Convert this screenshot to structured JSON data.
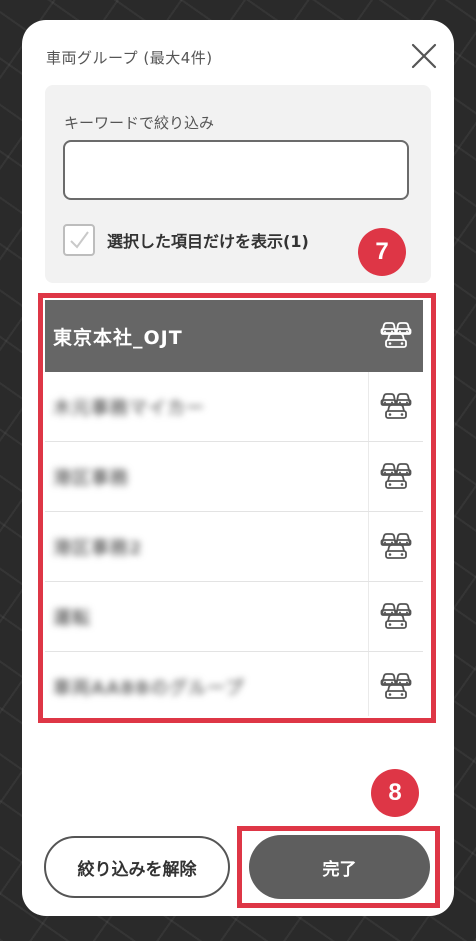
{
  "modal": {
    "title": "車両グループ (最大4件)",
    "filter": {
      "keyword_label": "キーワードで絞り込み",
      "keyword_value": "",
      "show_selected_label": "選択した項目だけを表示(1)",
      "show_selected_checked": true
    },
    "groups": [
      {
        "name": "東京本社_OJT",
        "selected": true,
        "blurred": false,
        "icon": "car-group-icon"
      },
      {
        "name": "木元事務マイカー",
        "selected": false,
        "blurred": true,
        "icon": "car-group-icon"
      },
      {
        "name": "港区事務",
        "selected": false,
        "blurred": true,
        "icon": "car-group-icon"
      },
      {
        "name": "港区事務2",
        "selected": false,
        "blurred": true,
        "icon": "car-group-icon"
      },
      {
        "name": "運転",
        "selected": false,
        "blurred": true,
        "icon": "car-group-icon"
      },
      {
        "name": "車両AABBのグループ",
        "selected": false,
        "blurred": true,
        "icon": "car-group-icon"
      }
    ],
    "buttons": {
      "clear_label": "絞り込みを解除",
      "done_label": "完了"
    }
  },
  "annotations": {
    "badge_7": "7",
    "badge_8": "8"
  },
  "colors": {
    "accent": "#de3646",
    "selected_row": "#666666",
    "done_button": "#5e5e5e"
  }
}
